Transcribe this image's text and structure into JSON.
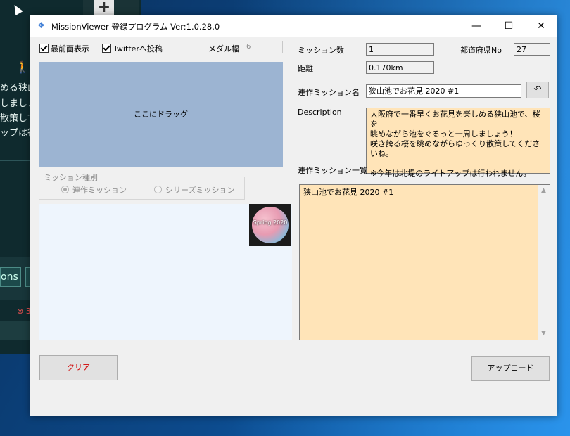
{
  "background_app": {
    "lines": [
      "める狭山",
      "しましょ",
      "散策して",
      "ップは行"
    ],
    "button_text": "ons",
    "error_text": "3"
  },
  "window": {
    "title": "MissionViewer 登録プログラム Ver:1.0.28.0",
    "controls": {
      "minimize": "—",
      "maximize": "☐",
      "close": "✕"
    }
  },
  "options": {
    "topmost_label": "最前面表示",
    "topmost_checked": true,
    "twitter_label": "Twitterへ投稿",
    "twitter_checked": true,
    "medal_width_label": "メダル幅",
    "medal_width_value": "6"
  },
  "drop_area": {
    "label": "ここにドラッグ"
  },
  "mission_type": {
    "group_label": "ミッション種別",
    "options": [
      {
        "label": "連作ミッション",
        "selected": true
      },
      {
        "label": "シリーズミッション",
        "selected": false
      }
    ]
  },
  "medal": {
    "text": "Spring 2020"
  },
  "info": {
    "mission_count_label": "ミッション数",
    "mission_count_value": "1",
    "prefecture_no_label": "都道府県No",
    "prefecture_no_value": "27",
    "distance_label": "距離",
    "distance_value": "0.170km",
    "series_name_label": "連作ミッション名",
    "series_name_value": "狭山池でお花見 2020 #1",
    "description_label": "Description",
    "description_value": "大阪府で一番早くお花見を楽しめる狭山池で、桜を\n眺めながら池をぐるっと一周しましょう！\n咲き誇る桜を眺めながらゆっくり散策してくださいね。\n\n※今年は北堤のライトアップは行われません。",
    "series_list_label": "連作ミッション一覧",
    "series_list": [
      "狭山池でお花見 2020 #1"
    ]
  },
  "buttons": {
    "clear": "クリア",
    "upload": "アップロード",
    "undo_icon": "↶"
  },
  "colors": {
    "drop_area": "#9cb4d2",
    "description_bg": "#ffe4b8",
    "clear_text": "#d00000"
  }
}
